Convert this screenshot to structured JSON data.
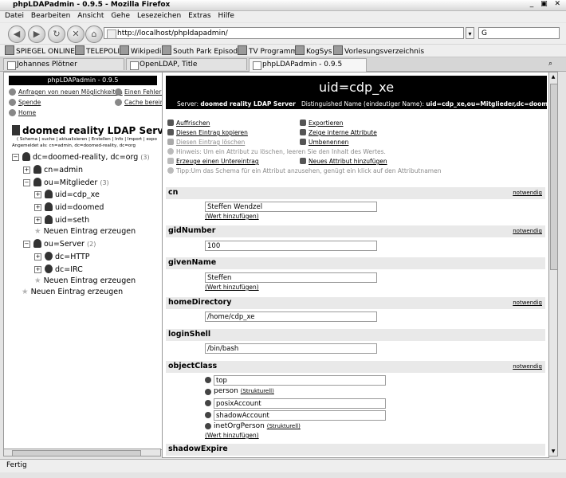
{
  "window": {
    "title": "phpLDAPadmin - 0.9.5 - Mozilla Firefox",
    "controls": "_ ▣ ✕"
  },
  "menu": [
    "Datei",
    "Bearbeiten",
    "Ansicht",
    "Gehe",
    "Lesezeichen",
    "Extras",
    "Hilfe"
  ],
  "nav": {
    "url": "http://localhost/phpldapadmin/",
    "search_placeholder": "G"
  },
  "bookmarks": [
    "SPIEGEL ONLINE",
    "TELEPOLIS",
    "Wikipedia",
    "South Park Episodes",
    "TV Programm",
    "KogSys",
    "Vorlesungsverzeichnis"
  ],
  "tabs": [
    {
      "label": "Johannes Plötner",
      "active": false
    },
    {
      "label": "OpenLDAP, Title",
      "active": false
    },
    {
      "label": "phpLDAPadmin - 0.9.5",
      "active": true
    }
  ],
  "left": {
    "header": "phpLDAPadmin - 0.9.5",
    "links": {
      "feature_request": "Anfragen von neuen Möglichkeiten",
      "bug_report": "Einen Fehler b",
      "donate": "Spende",
      "purge_cache": "Cache bereini",
      "home": "Home"
    },
    "server_name": "doomed reality LDAP Server",
    "server_links": "( Schema | suche | aktualisieren | Erstellen | Info | Import | expo",
    "logged_in": "Angemeldet als: cn=admin, dc=doomed-reality, dc=org",
    "tree": {
      "root": {
        "label": "dc=doomed-reality, dc=org",
        "count": "(3)"
      },
      "admin": "cn=admin",
      "mitglieder": {
        "label": "ou=Mitglieder",
        "count": "(3)"
      },
      "members": [
        "uid=cdp_xe",
        "uid=doomed",
        "uid=seth"
      ],
      "server": {
        "label": "ou=Server",
        "count": "(2)"
      },
      "servers": [
        "dc=HTTP",
        "dc=IRC"
      ],
      "new_entry": "Neuen Eintrag erzeugen"
    }
  },
  "right": {
    "title": "uid=cdp_xe",
    "server_label": "Server:",
    "server_value": "doomed reality LDAP Server",
    "dn_label": "Distinguished Name (eindeutiger Name):",
    "dn_value": "uid=cdp_xe,ou=Mitglieder,dc=doomed-reality,dc=org",
    "actions": {
      "refresh": "Auffrischen",
      "export": "Exportieren",
      "copy": "Diesen Eintrag kopieren",
      "show_internal": "Zeige interne Attribute",
      "delete": "Diesen Eintrag löschen",
      "rename": "Umbenennen",
      "hint_delete": "Hinweis: Um ein Attribut zu löschen, leeren Sie den Inhalt des Wertes.",
      "create_child": "Erzeuge einen Untereintrag",
      "new_attr": "Neues Attribut hinzufügen",
      "tip_schema": "Tipp:Um das Schema für ein Attribut anzusehen, genügt ein klick auf den Attributnamen"
    },
    "required": "notwendig",
    "add_value": "(Wert hinzufügen)",
    "attributes": {
      "cn": {
        "name": "cn",
        "value": "Steffen Wendzel"
      },
      "gidNumber": {
        "name": "gidNumber",
        "value": "100"
      },
      "givenName": {
        "name": "givenName",
        "value": "Steffen"
      },
      "homeDirectory": {
        "name": "homeDirectory",
        "value": "/home/cdp_xe"
      },
      "loginShell": {
        "name": "loginShell",
        "value": "/bin/bash"
      },
      "objectClass": {
        "name": "objectClass"
      },
      "shadowExpire": {
        "name": "shadowExpire"
      }
    },
    "objectclasses": {
      "top": "top",
      "person": "person",
      "person_note": "(Strukturell)",
      "posix": "posixAccount",
      "shadow": "shadowAccount",
      "inetorg": "inetOrgPerson",
      "inetorg_note": "(Strukturell)"
    }
  },
  "status": "Fertig"
}
